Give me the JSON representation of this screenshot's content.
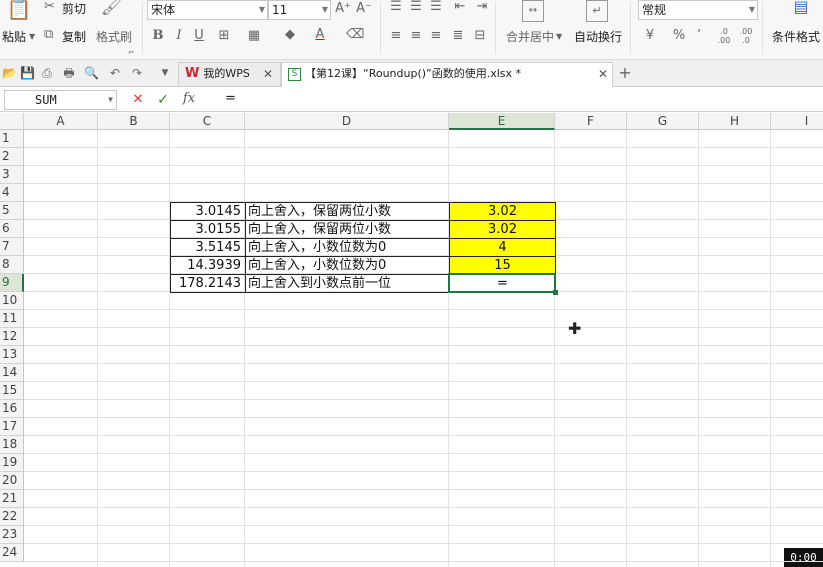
{
  "ribbon": {
    "paste_label": "粘贴",
    "cut_label": "剪切",
    "copy_label": "复制",
    "format_painter_label": "格式刷",
    "font_name": "宋体",
    "font_size": "11",
    "font_grow": "A⁺",
    "font_shrink": "A⁻",
    "bold": "B",
    "italic": "I",
    "underline": "U",
    "merge_center_label": "合并居中",
    "wrap_text_label": "自动换行",
    "number_format": "常规",
    "percent": "%",
    "comma": "’",
    "conditional_format_label": "条件格式"
  },
  "tabs": [
    {
      "label": "我的WPS",
      "active": false
    },
    {
      "label": "【第12课】“Roundup()”函数的使用.xlsx *",
      "active": true
    }
  ],
  "formula_bar": {
    "name_box": "SUM",
    "cancel_icon": "✕",
    "confirm_icon": "✓",
    "fx_label": "fx",
    "content": "="
  },
  "grid": {
    "columns": [
      "A",
      "B",
      "C",
      "D",
      "E",
      "F",
      "G",
      "H",
      "I"
    ],
    "selected_column": "E",
    "rows": [
      "1",
      "2",
      "3",
      "4",
      "5",
      "6",
      "7",
      "8",
      "9",
      "10",
      "11",
      "12",
      "13",
      "14",
      "15",
      "16",
      "17",
      "18",
      "19",
      "20",
      "21",
      "22",
      "23",
      "24"
    ],
    "selected_row": "9",
    "data_rows": [
      {
        "row": "5",
        "c": "3.0145",
        "d": "向上舍入，保留两位小数",
        "e": "3.02"
      },
      {
        "row": "6",
        "c": "3.0155",
        "d": "向上舍入，保留两位小数",
        "e": "3.02"
      },
      {
        "row": "7",
        "c": "3.5145",
        "d": "向上舍入，小数位数为0",
        "e": "4"
      },
      {
        "row": "8",
        "c": "14.3939",
        "d": "向上舍入，小数位数为0",
        "e": "15"
      },
      {
        "row": "9",
        "c": "178.2143",
        "d": "向上舍入到小数点前一位",
        "e": "="
      }
    ],
    "highlight_color": "#ffff00",
    "active_cell_color": "#217346"
  },
  "overlay": {
    "timer": "0:00"
  }
}
